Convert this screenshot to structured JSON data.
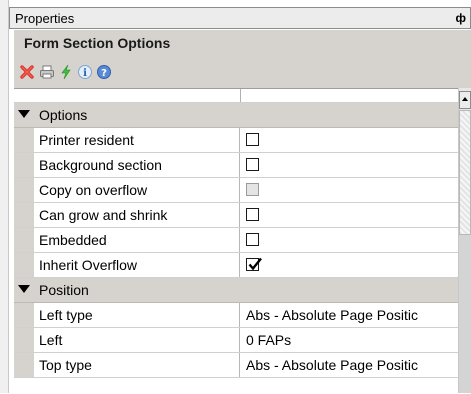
{
  "panel": {
    "title": "Properties",
    "pin_glyph": "ф"
  },
  "section": {
    "title": "Form Section Options"
  },
  "toolbar": {
    "icons": [
      "delete-icon",
      "print-icon",
      "lightning-icon",
      "info-icon",
      "help-icon"
    ]
  },
  "grid": {
    "groups": [
      {
        "label": "Options",
        "expanded": true,
        "rows": [
          {
            "name": "Printer resident",
            "type": "checkbox",
            "checked": false
          },
          {
            "name": "Background section",
            "type": "checkbox",
            "checked": false
          },
          {
            "name": "Copy on overflow",
            "type": "checkbox",
            "checked": false,
            "disabled": true
          },
          {
            "name": "Can grow and shrink",
            "type": "checkbox",
            "checked": false
          },
          {
            "name": "Embedded",
            "type": "checkbox",
            "checked": false
          },
          {
            "name": "Inherit Overflow",
            "type": "checkbox",
            "checked": true
          }
        ]
      },
      {
        "label": "Position",
        "expanded": true,
        "rows": [
          {
            "name": "Left type",
            "type": "text",
            "value": "Abs - Absolute Page Positic"
          },
          {
            "name": "Left",
            "type": "text",
            "value": "0 FAPs"
          },
          {
            "name": "Top type",
            "type": "text",
            "value": "Abs - Absolute Page Positic"
          }
        ]
      }
    ]
  },
  "colors": {
    "group_bg": "#d6d3ce",
    "grid_line": "#d0d0d0"
  }
}
